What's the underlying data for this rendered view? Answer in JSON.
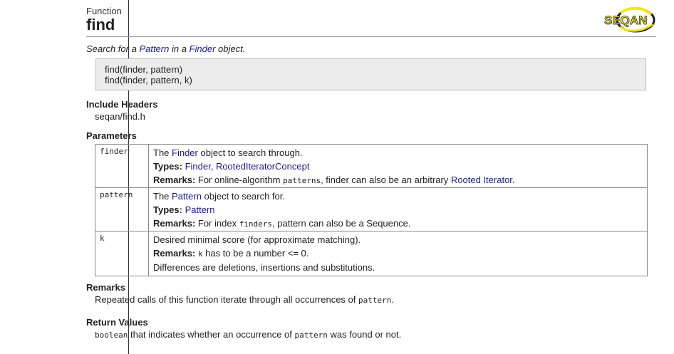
{
  "header": {
    "kind": "Function",
    "name": "find",
    "logo_text": "SEQAN"
  },
  "summary": {
    "pre": "Search for a ",
    "link1": "Pattern",
    "mid": " in a ",
    "link2": "Finder",
    "post": " object."
  },
  "signature": {
    "line1": "find(finder, pattern)",
    "line2": "find(finder, pattern, k)"
  },
  "include": {
    "heading": "Include Headers",
    "file": "seqan/find.h"
  },
  "parameters": {
    "heading": "Parameters",
    "finder": {
      "name": "finder",
      "d_pre": "The ",
      "d_link": "Finder",
      "d_post": " object to search through.",
      "types_label": "Types:",
      "types_sp": " ",
      "type1": "Finder",
      "types_sep": ", ",
      "type2": "RootedIteratorConcept",
      "remarks_label": "Remarks:",
      "r_pre": " For online-algorithm ",
      "r_code": "patterns",
      "r_mid": ", finder can also be an arbitrary ",
      "r_link": "Rooted Iterator",
      "r_post": "."
    },
    "pattern": {
      "name": "pattern",
      "d_pre": "The ",
      "d_link": "Pattern",
      "d_post": " object to search for.",
      "types_label": "Types:",
      "types_sp": " ",
      "type1": "Pattern",
      "remarks_label": "Remarks:",
      "r_pre": " For index ",
      "r_code": "finders",
      "r_post": ", pattern can also be a Sequence."
    },
    "k": {
      "name": "k",
      "desc": "Desired minimal score (for approximate matching).",
      "remarks_label": "Remarks:",
      "r_sp": " ",
      "r_code": "k",
      "r_post": " has to be a number <= 0.",
      "extra": "Differences are deletions, insertions and substitutions."
    }
  },
  "remarks": {
    "heading": "Remarks",
    "pre": "Repeated calls of this function iterate through all occurrences of ",
    "code": "pattern",
    "post": "."
  },
  "return_values": {
    "heading": "Return Values",
    "code": "boolean",
    "mid": " that indicates whether an occurrence of ",
    "code2": "pattern",
    "post": " was found or not."
  },
  "colors": {
    "link": "#1a1a8c",
    "logo_yellow": "#f2e51f"
  }
}
